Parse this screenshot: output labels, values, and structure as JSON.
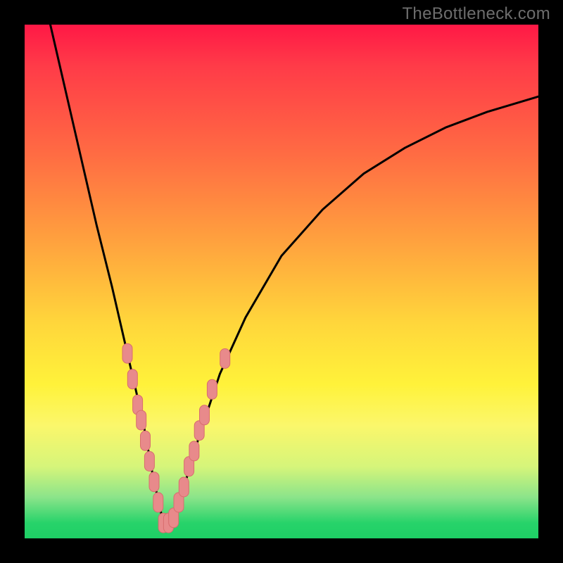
{
  "watermark": "TheBottleneck.com",
  "colors": {
    "frame": "#000000",
    "curve": "#000000",
    "marker_fill": "#e88a8b",
    "marker_stroke": "#d86d6e"
  },
  "chart_data": {
    "type": "line",
    "title": "",
    "xlabel": "",
    "ylabel": "",
    "xlim": [
      0,
      100
    ],
    "ylim": [
      0,
      100
    ],
    "grid": false,
    "legend": false,
    "note": "Values are read off the bottleneck V-curve in plot-relative percent units (0=left/top of plot, 100=right/bottom). y is the bottleneck percentage where 0≈bottom/green and 100≈top/red. Minimum at x≈27.",
    "series": [
      {
        "name": "bottleneck-curve",
        "x": [
          5,
          8,
          11,
          14,
          17,
          20,
          23,
          25,
          27,
          29,
          31,
          34,
          38,
          43,
          50,
          58,
          66,
          74,
          82,
          90,
          100
        ],
        "y": [
          100,
          87,
          74,
          61,
          49,
          36,
          23,
          12,
          3,
          4,
          10,
          20,
          32,
          43,
          55,
          64,
          71,
          76,
          80,
          83,
          86
        ]
      }
    ],
    "markers": {
      "name": "highlighted-points",
      "note": "Salmon pill/dot markers clustered near the valley on both arms.",
      "points": [
        {
          "x": 20.0,
          "y": 36
        },
        {
          "x": 21.0,
          "y": 31
        },
        {
          "x": 22.0,
          "y": 26
        },
        {
          "x": 22.7,
          "y": 23
        },
        {
          "x": 23.5,
          "y": 19
        },
        {
          "x": 24.3,
          "y": 15
        },
        {
          "x": 25.2,
          "y": 11
        },
        {
          "x": 26.0,
          "y": 7
        },
        {
          "x": 27.0,
          "y": 3
        },
        {
          "x": 28.0,
          "y": 3
        },
        {
          "x": 29.0,
          "y": 4
        },
        {
          "x": 30.0,
          "y": 7
        },
        {
          "x": 31.0,
          "y": 10
        },
        {
          "x": 32.0,
          "y": 14
        },
        {
          "x": 33.0,
          "y": 17
        },
        {
          "x": 34.0,
          "y": 21
        },
        {
          "x": 35.0,
          "y": 24
        },
        {
          "x": 36.5,
          "y": 29
        },
        {
          "x": 39.0,
          "y": 35
        }
      ]
    }
  }
}
